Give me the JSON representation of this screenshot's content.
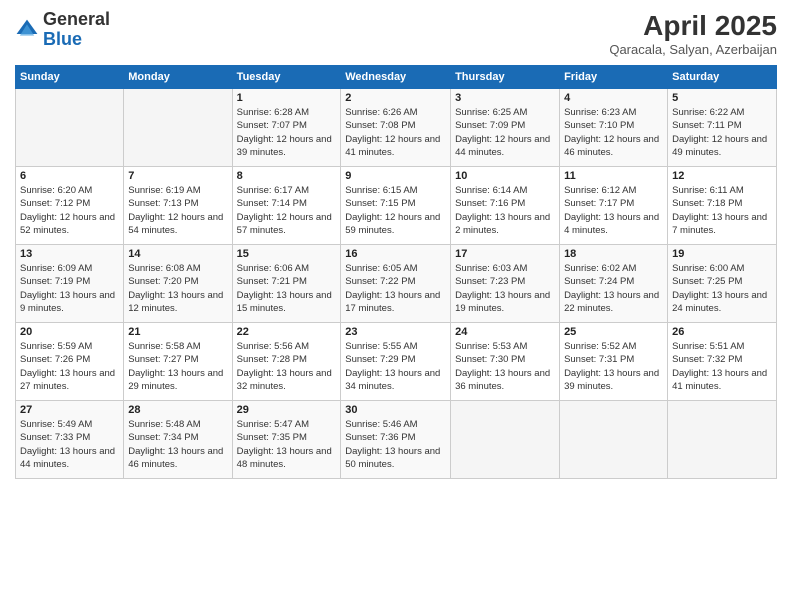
{
  "header": {
    "logo_general": "General",
    "logo_blue": "Blue",
    "month_year": "April 2025",
    "location": "Qaracala, Salyan, Azerbaijan"
  },
  "days_of_week": [
    "Sunday",
    "Monday",
    "Tuesday",
    "Wednesday",
    "Thursday",
    "Friday",
    "Saturday"
  ],
  "weeks": [
    [
      {
        "day": "",
        "sunrise": "",
        "sunset": "",
        "daylight": ""
      },
      {
        "day": "",
        "sunrise": "",
        "sunset": "",
        "daylight": ""
      },
      {
        "day": "1",
        "sunrise": "Sunrise: 6:28 AM",
        "sunset": "Sunset: 7:07 PM",
        "daylight": "Daylight: 12 hours and 39 minutes."
      },
      {
        "day": "2",
        "sunrise": "Sunrise: 6:26 AM",
        "sunset": "Sunset: 7:08 PM",
        "daylight": "Daylight: 12 hours and 41 minutes."
      },
      {
        "day": "3",
        "sunrise": "Sunrise: 6:25 AM",
        "sunset": "Sunset: 7:09 PM",
        "daylight": "Daylight: 12 hours and 44 minutes."
      },
      {
        "day": "4",
        "sunrise": "Sunrise: 6:23 AM",
        "sunset": "Sunset: 7:10 PM",
        "daylight": "Daylight: 12 hours and 46 minutes."
      },
      {
        "day": "5",
        "sunrise": "Sunrise: 6:22 AM",
        "sunset": "Sunset: 7:11 PM",
        "daylight": "Daylight: 12 hours and 49 minutes."
      }
    ],
    [
      {
        "day": "6",
        "sunrise": "Sunrise: 6:20 AM",
        "sunset": "Sunset: 7:12 PM",
        "daylight": "Daylight: 12 hours and 52 minutes."
      },
      {
        "day": "7",
        "sunrise": "Sunrise: 6:19 AM",
        "sunset": "Sunset: 7:13 PM",
        "daylight": "Daylight: 12 hours and 54 minutes."
      },
      {
        "day": "8",
        "sunrise": "Sunrise: 6:17 AM",
        "sunset": "Sunset: 7:14 PM",
        "daylight": "Daylight: 12 hours and 57 minutes."
      },
      {
        "day": "9",
        "sunrise": "Sunrise: 6:15 AM",
        "sunset": "Sunset: 7:15 PM",
        "daylight": "Daylight: 12 hours and 59 minutes."
      },
      {
        "day": "10",
        "sunrise": "Sunrise: 6:14 AM",
        "sunset": "Sunset: 7:16 PM",
        "daylight": "Daylight: 13 hours and 2 minutes."
      },
      {
        "day": "11",
        "sunrise": "Sunrise: 6:12 AM",
        "sunset": "Sunset: 7:17 PM",
        "daylight": "Daylight: 13 hours and 4 minutes."
      },
      {
        "day": "12",
        "sunrise": "Sunrise: 6:11 AM",
        "sunset": "Sunset: 7:18 PM",
        "daylight": "Daylight: 13 hours and 7 minutes."
      }
    ],
    [
      {
        "day": "13",
        "sunrise": "Sunrise: 6:09 AM",
        "sunset": "Sunset: 7:19 PM",
        "daylight": "Daylight: 13 hours and 9 minutes."
      },
      {
        "day": "14",
        "sunrise": "Sunrise: 6:08 AM",
        "sunset": "Sunset: 7:20 PM",
        "daylight": "Daylight: 13 hours and 12 minutes."
      },
      {
        "day": "15",
        "sunrise": "Sunrise: 6:06 AM",
        "sunset": "Sunset: 7:21 PM",
        "daylight": "Daylight: 13 hours and 15 minutes."
      },
      {
        "day": "16",
        "sunrise": "Sunrise: 6:05 AM",
        "sunset": "Sunset: 7:22 PM",
        "daylight": "Daylight: 13 hours and 17 minutes."
      },
      {
        "day": "17",
        "sunrise": "Sunrise: 6:03 AM",
        "sunset": "Sunset: 7:23 PM",
        "daylight": "Daylight: 13 hours and 19 minutes."
      },
      {
        "day": "18",
        "sunrise": "Sunrise: 6:02 AM",
        "sunset": "Sunset: 7:24 PM",
        "daylight": "Daylight: 13 hours and 22 minutes."
      },
      {
        "day": "19",
        "sunrise": "Sunrise: 6:00 AM",
        "sunset": "Sunset: 7:25 PM",
        "daylight": "Daylight: 13 hours and 24 minutes."
      }
    ],
    [
      {
        "day": "20",
        "sunrise": "Sunrise: 5:59 AM",
        "sunset": "Sunset: 7:26 PM",
        "daylight": "Daylight: 13 hours and 27 minutes."
      },
      {
        "day": "21",
        "sunrise": "Sunrise: 5:58 AM",
        "sunset": "Sunset: 7:27 PM",
        "daylight": "Daylight: 13 hours and 29 minutes."
      },
      {
        "day": "22",
        "sunrise": "Sunrise: 5:56 AM",
        "sunset": "Sunset: 7:28 PM",
        "daylight": "Daylight: 13 hours and 32 minutes."
      },
      {
        "day": "23",
        "sunrise": "Sunrise: 5:55 AM",
        "sunset": "Sunset: 7:29 PM",
        "daylight": "Daylight: 13 hours and 34 minutes."
      },
      {
        "day": "24",
        "sunrise": "Sunrise: 5:53 AM",
        "sunset": "Sunset: 7:30 PM",
        "daylight": "Daylight: 13 hours and 36 minutes."
      },
      {
        "day": "25",
        "sunrise": "Sunrise: 5:52 AM",
        "sunset": "Sunset: 7:31 PM",
        "daylight": "Daylight: 13 hours and 39 minutes."
      },
      {
        "day": "26",
        "sunrise": "Sunrise: 5:51 AM",
        "sunset": "Sunset: 7:32 PM",
        "daylight": "Daylight: 13 hours and 41 minutes."
      }
    ],
    [
      {
        "day": "27",
        "sunrise": "Sunrise: 5:49 AM",
        "sunset": "Sunset: 7:33 PM",
        "daylight": "Daylight: 13 hours and 44 minutes."
      },
      {
        "day": "28",
        "sunrise": "Sunrise: 5:48 AM",
        "sunset": "Sunset: 7:34 PM",
        "daylight": "Daylight: 13 hours and 46 minutes."
      },
      {
        "day": "29",
        "sunrise": "Sunrise: 5:47 AM",
        "sunset": "Sunset: 7:35 PM",
        "daylight": "Daylight: 13 hours and 48 minutes."
      },
      {
        "day": "30",
        "sunrise": "Sunrise: 5:46 AM",
        "sunset": "Sunset: 7:36 PM",
        "daylight": "Daylight: 13 hours and 50 minutes."
      },
      {
        "day": "",
        "sunrise": "",
        "sunset": "",
        "daylight": ""
      },
      {
        "day": "",
        "sunrise": "",
        "sunset": "",
        "daylight": ""
      },
      {
        "day": "",
        "sunrise": "",
        "sunset": "",
        "daylight": ""
      }
    ]
  ]
}
